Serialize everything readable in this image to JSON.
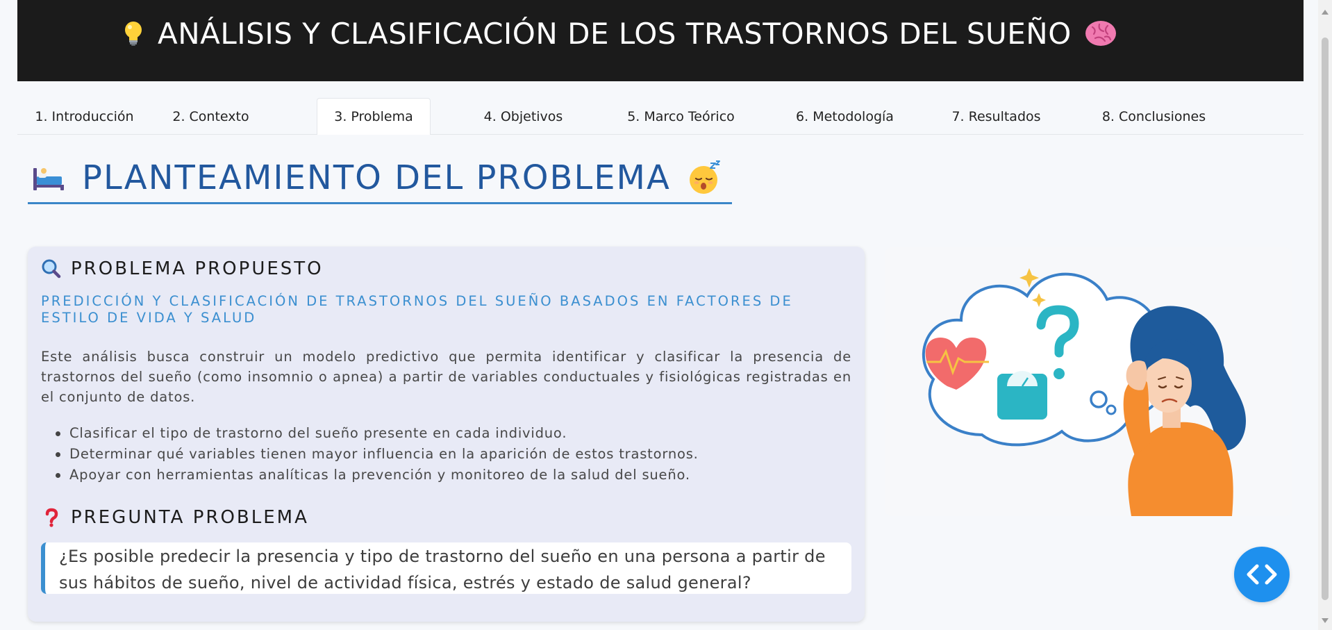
{
  "header": {
    "title": "ANÁLISIS Y CLASIFICACIÓN DE LOS TRASTORNOS DEL SUEÑO",
    "left_icon": "lightbulb-icon",
    "right_icon": "brain-icon"
  },
  "tabs": [
    {
      "label": "1. Introducción"
    },
    {
      "label": "2. Contexto"
    },
    {
      "label": "3. Problema",
      "active": true
    },
    {
      "label": "4. Objetivos"
    },
    {
      "label": "5. Marco Teórico"
    },
    {
      "label": "6. Metodología"
    },
    {
      "label": "7. Resultados"
    },
    {
      "label": "8. Conclusiones"
    }
  ],
  "section": {
    "title": "PLANTEAMIENTO DEL PROBLEMA",
    "left_icon": "bed-icon",
    "right_icon": "sleeping-face-icon"
  },
  "card": {
    "heading": "PROBLEMA PROPUESTO",
    "heading_icon": "magnifier-icon",
    "subtitle": "PREDICCIÓN Y CLASIFICACIÓN DE TRASTORNOS DEL SUEÑO BASADOS EN FACTORES DE ESTILO DE VIDA Y SALUD",
    "paragraph": "Este análisis busca construir un modelo predictivo que permita identificar y clasificar la presencia de trastornos del sueño (como insomnio o apnea) a partir de variables conductuales y fisiológicas registradas en el conjunto de datos.",
    "bullets": [
      "Clasificar el tipo de trastorno del sueño presente en cada individuo.",
      "Determinar qué variables tienen mayor influencia en la aparición de estos trastornos.",
      "Apoyar con herramientas analíticas la prevención y monitoreo de la salud del sueño."
    ],
    "question_heading": "PREGUNTA PROBLEMA",
    "question_icon": "question-mark-icon",
    "question": "¿Es posible predecir la presencia y tipo de trastorno del sueño en una persona a partir de sus hábitos de sueño, nivel de actividad física, estrés y estado de salud general?"
  },
  "illustration": {
    "icon": "worried-woman-thinking-illustration"
  },
  "fab": {
    "icon": "code-icon"
  },
  "colors": {
    "accent": "#3b8fd0",
    "title_blue": "#22589e",
    "header_bg": "#1b1b1b",
    "card_bg": "#e8eaf6",
    "fab": "#1e90ee"
  }
}
